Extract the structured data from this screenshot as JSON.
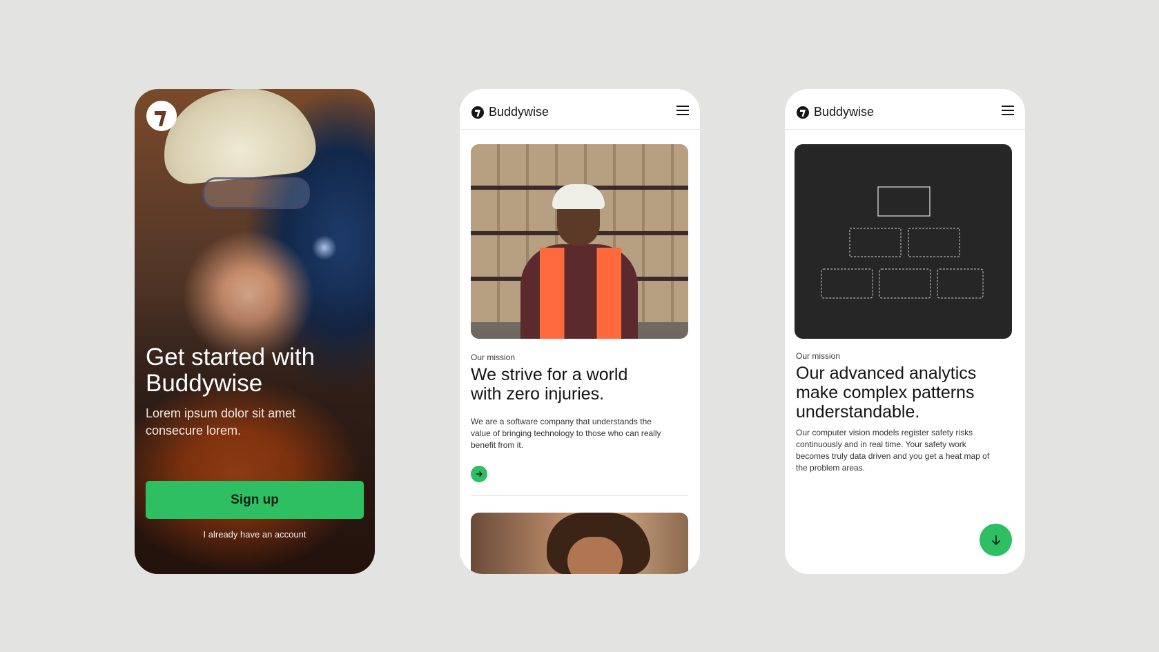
{
  "colors": {
    "background": "#e3e4e1",
    "accent_green": "#2ebf63",
    "dark_card": "#262626",
    "text_dark": "#141414"
  },
  "screen_signup": {
    "logo_icon": "buddywise-logo-icon",
    "title": "Get started with Buddywise",
    "subtitle": "Lorem ipsum dolor sit amet consecure lorem.",
    "signup_label": "Sign up",
    "login_link": "I already have an account"
  },
  "screen_mission": {
    "brand": "Buddywise",
    "menu_icon": "hamburger-menu-icon",
    "eyebrow": "Our mission",
    "title": "We strive for a world with zero injuries.",
    "body": "We are a software company that understands the value of bringing technology to those who can really benefit from it.",
    "cta_icon": "arrow-right-icon"
  },
  "screen_analytics": {
    "brand": "Buddywise",
    "menu_icon": "hamburger-menu-icon",
    "eyebrow": "Our mission",
    "title": "Our advanced analytics make complex patterns understandable.",
    "body": "Our computer vision models register safety risks continuously and in real time. Your safety work becomes truly data driven and you get a heat map of the problem areas.",
    "cta_icon": "arrow-down-icon"
  }
}
